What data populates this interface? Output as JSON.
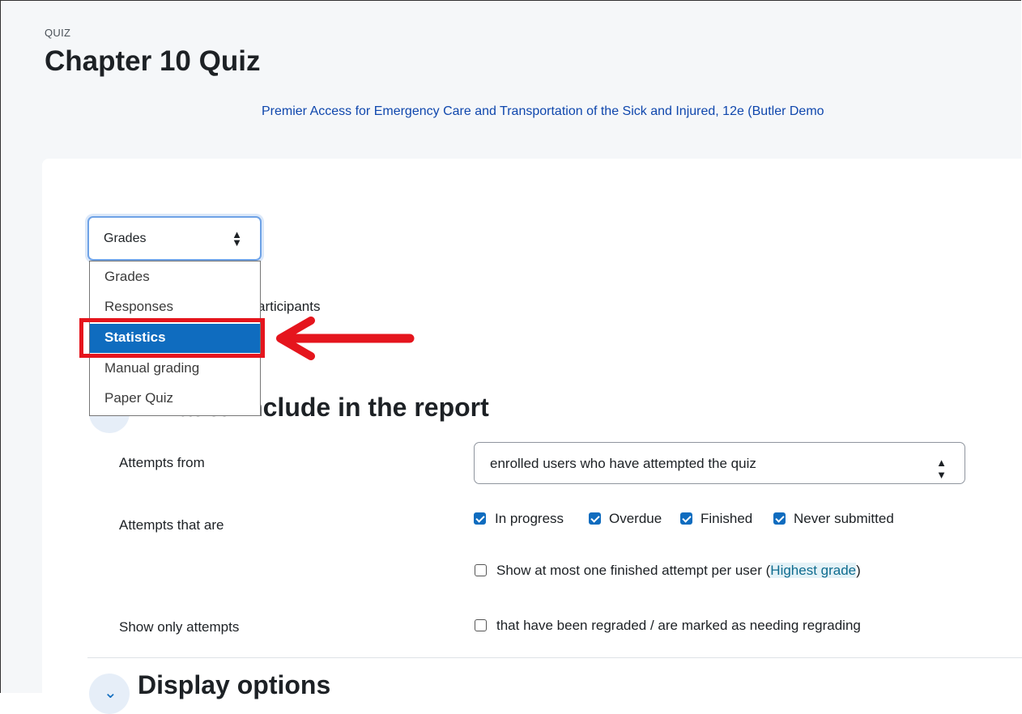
{
  "header": {
    "eyebrow": "QUIZ",
    "title": "Chapter 10 Quiz",
    "course_link": "Premier Access for Emergency Care and Transportation of the Sick and Injured, 12e (Butler Demo"
  },
  "report_select": {
    "value": "Grades",
    "options": [
      "Grades",
      "Responses",
      "Statistics",
      "Manual grading",
      "Paper Quiz"
    ],
    "highlighted": "Statistics"
  },
  "behind_text": "articipants",
  "section_include": {
    "title": "What to include in the report"
  },
  "attempts_from": {
    "label": "Attempts from",
    "value": "enrolled users who have attempted the quiz"
  },
  "attempts_that_are": {
    "label": "Attempts that are",
    "options": [
      {
        "label": "In progress",
        "checked": true
      },
      {
        "label": "Overdue",
        "checked": true
      },
      {
        "label": "Finished",
        "checked": true
      },
      {
        "label": "Never submitted",
        "checked": true
      }
    ],
    "one_attempt": {
      "label_prefix": "Show at most one finished attempt per user (",
      "link": "Highest grade",
      "label_suffix": ")",
      "checked": false
    }
  },
  "show_only": {
    "label": "Show only attempts",
    "option": "that have been regraded / are marked as needing regrading",
    "checked": false
  },
  "section_display": {
    "title": "Display options"
  },
  "colors": {
    "accent": "#0f6cbf",
    "annotation": "#e5151d"
  }
}
